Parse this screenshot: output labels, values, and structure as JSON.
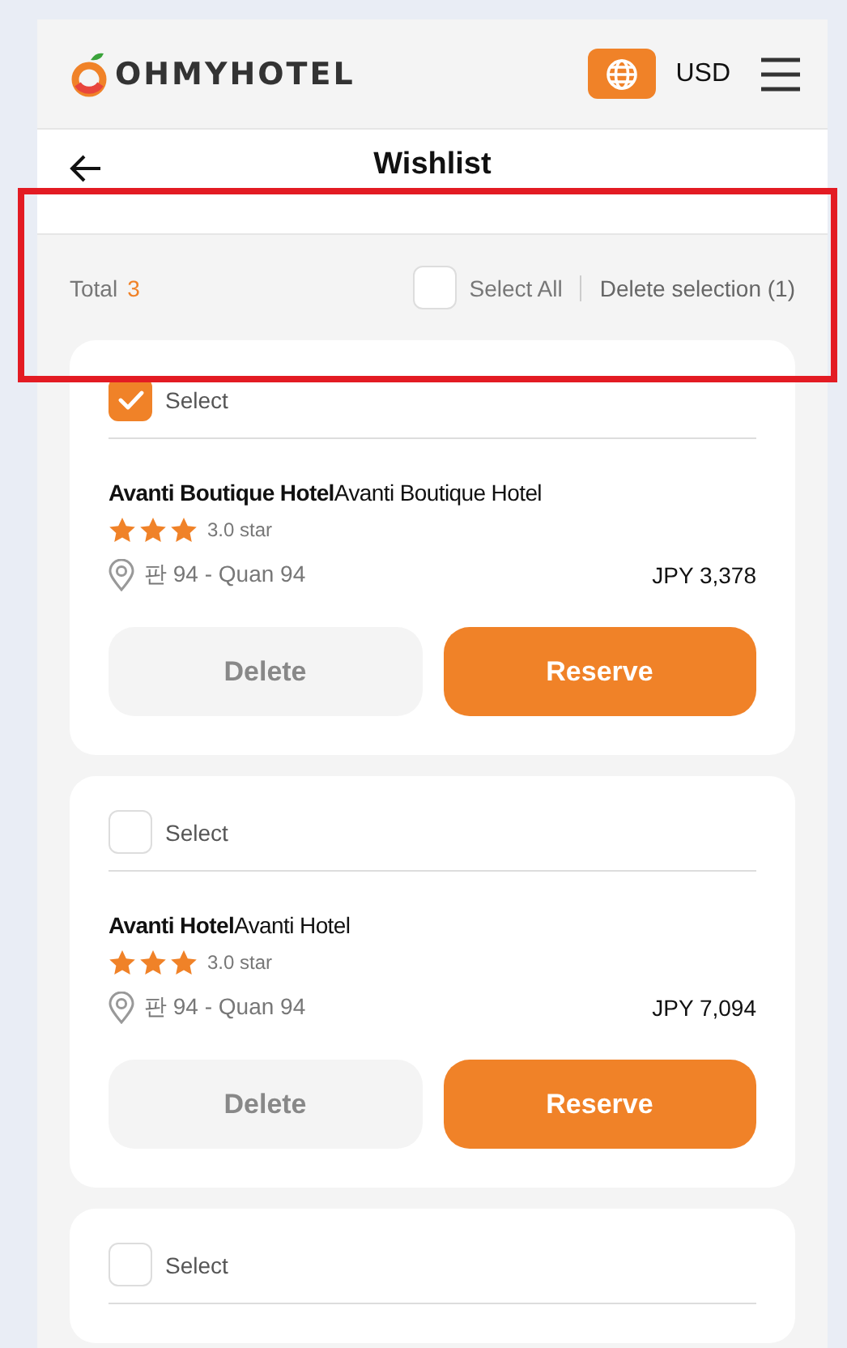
{
  "header": {
    "logo": "OHMYHOTEL",
    "currency": "USD"
  },
  "nav": {
    "title": "Wishlist"
  },
  "toolbar": {
    "total_label": "Total",
    "total_count": "3",
    "select_all": {
      "label": "Select All",
      "checked": false
    },
    "delete_selection": "Delete selection (1)"
  },
  "cards": [
    {
      "select": {
        "label": "Select",
        "checked": true
      },
      "name": "**Avanti Boutique Hotel**Avanti Boutique Hotel",
      "stars": 3,
      "rating": "3.0 star",
      "location": "판 94 - Quan 94",
      "price": "JPY 3,378",
      "buttons": [
        "Delete",
        "Reserve"
      ]
    },
    {
      "select": {
        "label": "Select",
        "checked": false
      },
      "name": "**Avanti Hotel**Avanti Hotel",
      "stars": 3,
      "rating": "3.0 star",
      "location": "판 94 - Quan 94",
      "price": "JPY 7,094",
      "buttons": [
        "Delete",
        "Reserve"
      ]
    },
    {
      "select": {
        "label": "Select",
        "checked": false
      }
    }
  ],
  "annotation": {
    "kind": "rectangle"
  }
}
